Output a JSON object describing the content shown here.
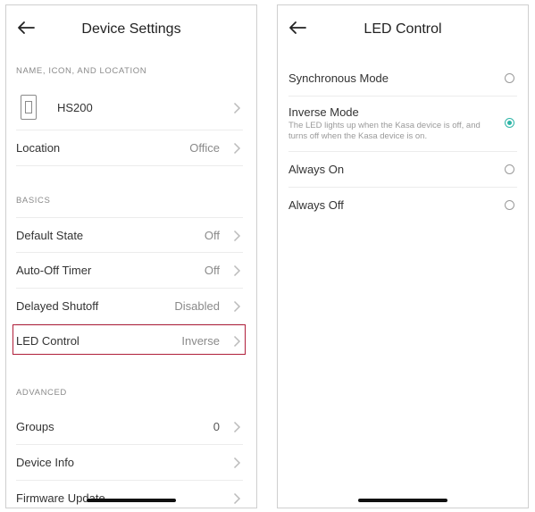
{
  "left_screen": {
    "title": "Device Settings",
    "sections": {
      "name_icon_location": "NAME, ICON, AND LOCATION",
      "basics": "BASICS",
      "advanced": "ADVANCED"
    },
    "device_name": "HS200",
    "rows": {
      "location": {
        "label": "Location",
        "value": "Office"
      },
      "default_state": {
        "label": "Default State",
        "value": "Off"
      },
      "auto_off_timer": {
        "label": "Auto-Off Timer",
        "value": "Off"
      },
      "delayed_shutoff": {
        "label": "Delayed Shutoff",
        "value": "Disabled"
      },
      "led_control": {
        "label": "LED Control",
        "value": "Inverse"
      },
      "groups": {
        "label": "Groups",
        "value": "0"
      },
      "device_info": {
        "label": "Device Info",
        "value": ""
      },
      "firmware_update": {
        "label": "Firmware Update",
        "value": ""
      }
    },
    "highlight_color": "#b01e3a"
  },
  "right_screen": {
    "title": "LED Control",
    "options": [
      {
        "label": "Synchronous Mode",
        "selected": false
      },
      {
        "label": "Inverse Mode",
        "description": "The LED lights up when the Kasa device is off, and turns off when the Kasa device is on.",
        "selected": true
      },
      {
        "label": "Always On",
        "selected": false
      },
      {
        "label": "Always Off",
        "selected": false
      }
    ],
    "accent_color": "#2fb5a7"
  }
}
